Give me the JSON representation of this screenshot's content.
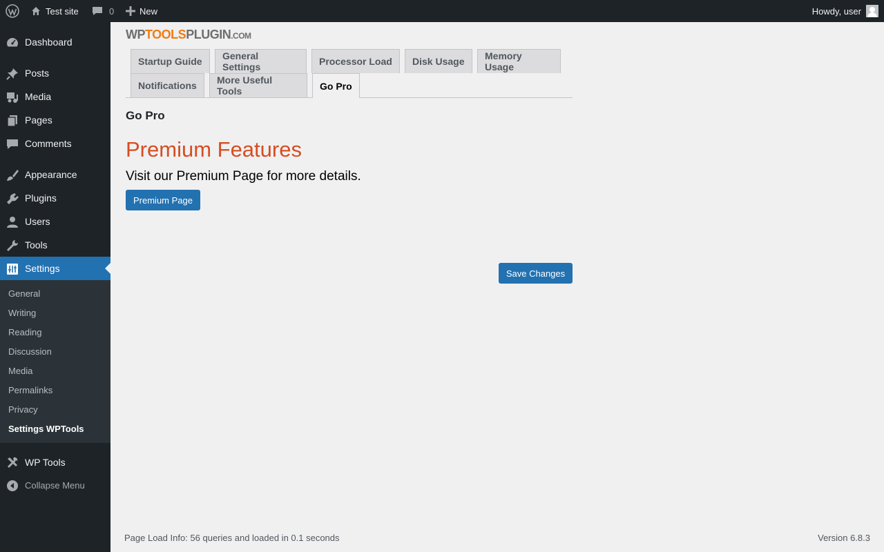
{
  "admin_bar": {
    "site_name": "Test site",
    "comments_count": "0",
    "new_label": "New",
    "howdy": "Howdy, user"
  },
  "sidebar": {
    "items": [
      {
        "label": "Dashboard",
        "icon": "dashboard-icon"
      },
      {
        "label": "Posts",
        "icon": "pin-icon"
      },
      {
        "label": "Media",
        "icon": "media-icon"
      },
      {
        "label": "Pages",
        "icon": "pages-icon"
      },
      {
        "label": "Comments",
        "icon": "comment-icon"
      },
      {
        "label": "Appearance",
        "icon": "brush-icon"
      },
      {
        "label": "Plugins",
        "icon": "plug-icon"
      },
      {
        "label": "Users",
        "icon": "user-icon"
      },
      {
        "label": "Tools",
        "icon": "wrench-icon"
      },
      {
        "label": "Settings",
        "icon": "settings-icon"
      },
      {
        "label": "WP Tools",
        "icon": "tools-icon"
      }
    ],
    "submenu": [
      "General",
      "Writing",
      "Reading",
      "Discussion",
      "Media",
      "Permalinks",
      "Privacy",
      "Settings WPTools"
    ],
    "collapse_label": "Collapse Menu"
  },
  "logo": {
    "part1": "WP",
    "part2": "TOOLS",
    "part3": "PLUGIN",
    "part4": ".COM"
  },
  "tabs": [
    "Startup Guide",
    "General Settings",
    "Processor Load",
    "Disk Usage",
    "Memory Usage",
    "Notifications",
    "More Useful Tools",
    "Go Pro"
  ],
  "active_tab": "Go Pro",
  "main": {
    "section_title": "Go Pro",
    "premium_heading": "Premium Features",
    "premium_text": "Visit our Premium Page for more details.",
    "premium_button": "Premium Page",
    "save_button": "Save Changes"
  },
  "footer": {
    "left": "Page Load Info: 56 queries and loaded in 0.1 seconds",
    "right": "Version 6.8.3"
  },
  "colors": {
    "admin_bg": "#1d2327",
    "accent": "#2271b1",
    "heading_accent": "#d54e21"
  }
}
